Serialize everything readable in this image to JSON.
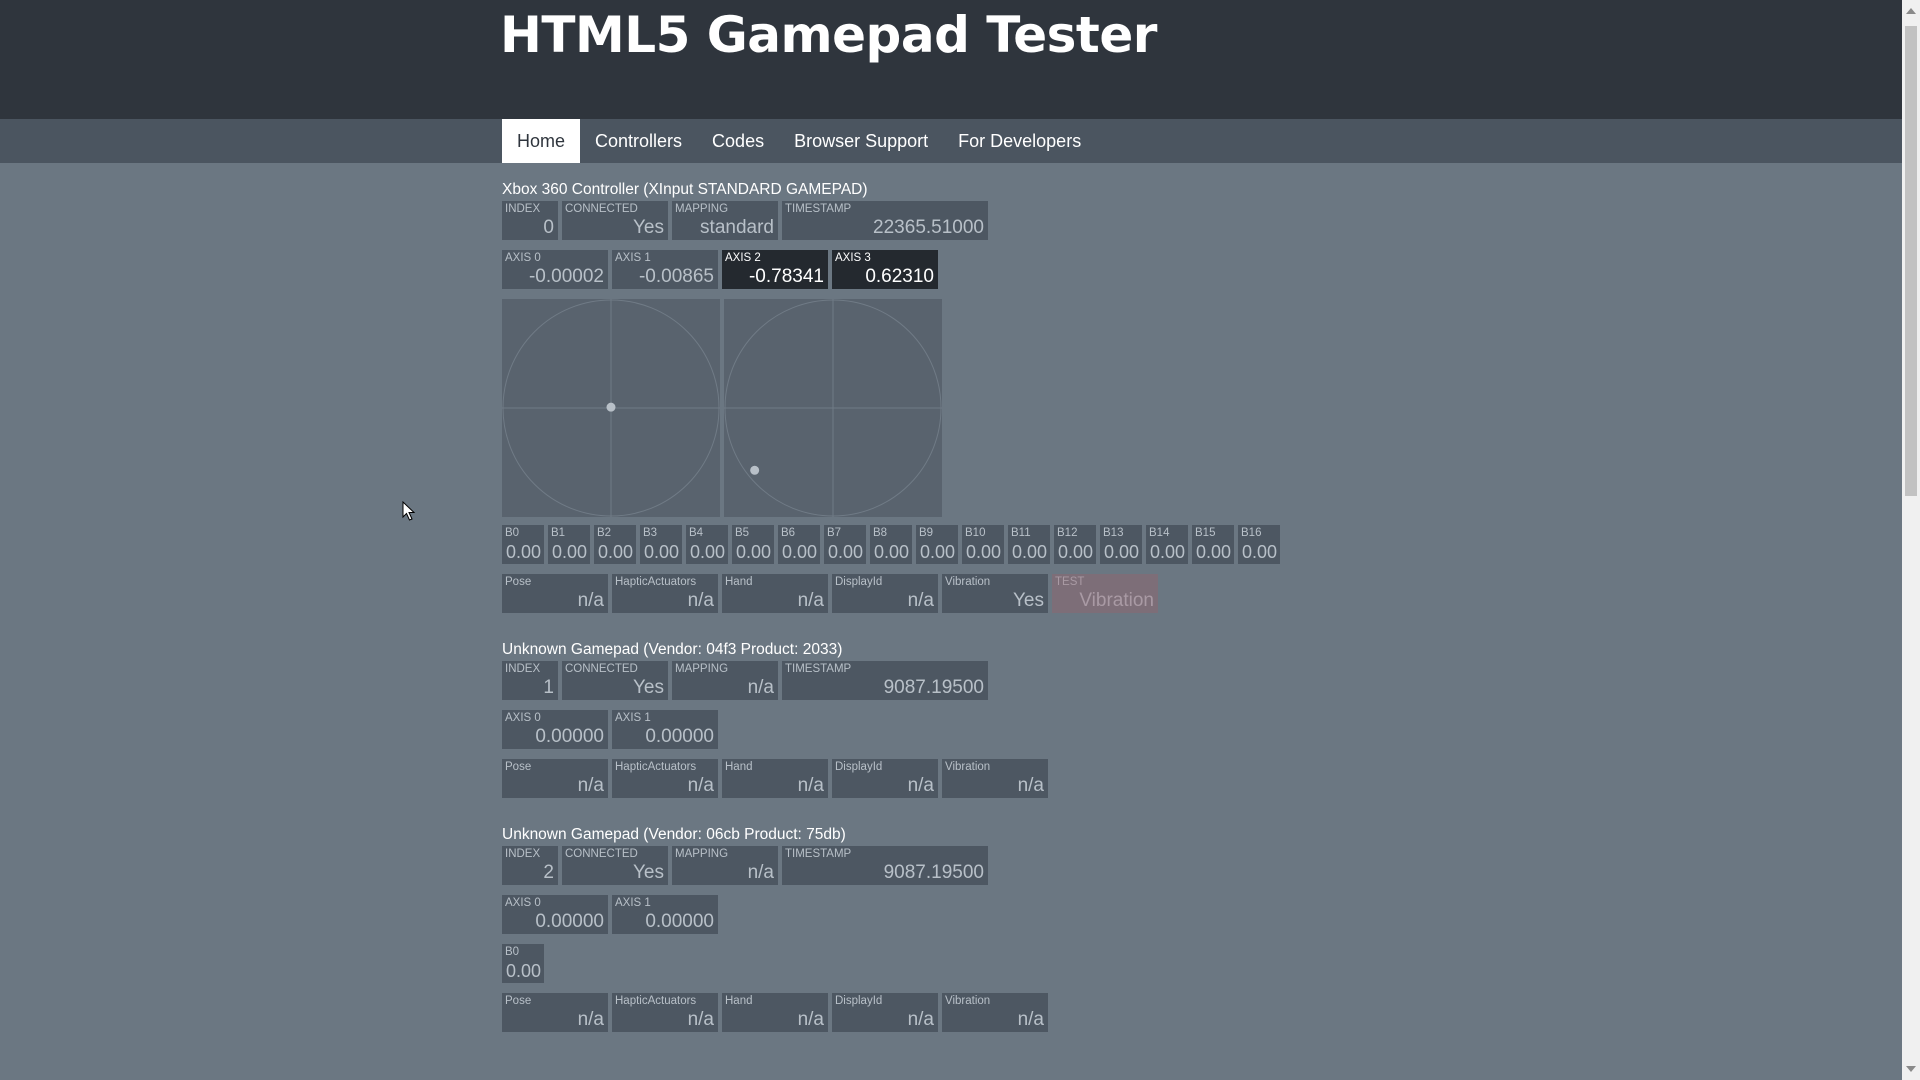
{
  "site": {
    "title": "HTML5 Gamepad Tester"
  },
  "nav": {
    "items": [
      {
        "label": "Home"
      },
      {
        "label": "Controllers"
      },
      {
        "label": "Codes"
      },
      {
        "label": "Browser Support"
      },
      {
        "label": "For Developers"
      }
    ],
    "active": "Home"
  },
  "gamepads": [
    {
      "title": "Xbox 360 Controller (XInput STANDARD GAMEPAD)",
      "info": [
        {
          "label": "INDEX",
          "value": "0"
        },
        {
          "label": "CONNECTED",
          "value": "Yes"
        },
        {
          "label": "MAPPING",
          "value": "standard"
        },
        {
          "label": "TIMESTAMP",
          "value": "22365.51000"
        }
      ],
      "axes": [
        {
          "label": "AXIS 0",
          "value": "-0.00002",
          "active": false
        },
        {
          "label": "AXIS 1",
          "value": "-0.00865",
          "active": false
        },
        {
          "label": "AXIS 2",
          "value": "-0.78341",
          "active": true
        },
        {
          "label": "AXIS 3",
          "value": "0.62310",
          "active": true
        }
      ],
      "sticks": [
        {
          "x": -2e-05,
          "y": -0.00865
        },
        {
          "x": -0.78341,
          "y": 0.6231
        }
      ],
      "buttons": [
        {
          "label": "B0",
          "value": "0.00"
        },
        {
          "label": "B1",
          "value": "0.00"
        },
        {
          "label": "B2",
          "value": "0.00"
        },
        {
          "label": "B3",
          "value": "0.00"
        },
        {
          "label": "B4",
          "value": "0.00"
        },
        {
          "label": "B5",
          "value": "0.00"
        },
        {
          "label": "B6",
          "value": "0.00"
        },
        {
          "label": "B7",
          "value": "0.00"
        },
        {
          "label": "B8",
          "value": "0.00"
        },
        {
          "label": "B9",
          "value": "0.00"
        },
        {
          "label": "B10",
          "value": "0.00"
        },
        {
          "label": "B11",
          "value": "0.00"
        },
        {
          "label": "B12",
          "value": "0.00"
        },
        {
          "label": "B13",
          "value": "0.00"
        },
        {
          "label": "B14",
          "value": "0.00"
        },
        {
          "label": "B15",
          "value": "0.00"
        },
        {
          "label": "B16",
          "value": "0.00"
        }
      ],
      "features": [
        {
          "label": "Pose",
          "value": "n/a"
        },
        {
          "label": "HapticActuators",
          "value": "n/a"
        },
        {
          "label": "Hand",
          "value": "n/a"
        },
        {
          "label": "DisplayId",
          "value": "n/a"
        },
        {
          "label": "Vibration",
          "value": "Yes"
        }
      ],
      "test": {
        "label": "TEST",
        "value": "Vibration"
      }
    },
    {
      "title": "Unknown Gamepad (Vendor: 04f3 Product: 2033)",
      "info": [
        {
          "label": "INDEX",
          "value": "1"
        },
        {
          "label": "CONNECTED",
          "value": "Yes"
        },
        {
          "label": "MAPPING",
          "value": "n/a"
        },
        {
          "label": "TIMESTAMP",
          "value": "9087.19500"
        }
      ],
      "axes": [
        {
          "label": "AXIS 0",
          "value": "0.00000"
        },
        {
          "label": "AXIS 1",
          "value": "0.00000"
        }
      ],
      "features": [
        {
          "label": "Pose",
          "value": "n/a"
        },
        {
          "label": "HapticActuators",
          "value": "n/a"
        },
        {
          "label": "Hand",
          "value": "n/a"
        },
        {
          "label": "DisplayId",
          "value": "n/a"
        },
        {
          "label": "Vibration",
          "value": "n/a"
        }
      ]
    },
    {
      "title": "Unknown Gamepad (Vendor: 06cb Product: 75db)",
      "info": [
        {
          "label": "INDEX",
          "value": "2"
        },
        {
          "label": "CONNECTED",
          "value": "Yes"
        },
        {
          "label": "MAPPING",
          "value": "n/a"
        },
        {
          "label": "TIMESTAMP",
          "value": "9087.19500"
        }
      ],
      "axes": [
        {
          "label": "AXIS 0",
          "value": "0.00000"
        },
        {
          "label": "AXIS 1",
          "value": "0.00000"
        }
      ],
      "buttons": [
        {
          "label": "B0",
          "value": "0.00"
        }
      ],
      "features": [
        {
          "label": "Pose",
          "value": "n/a"
        },
        {
          "label": "HapticActuators",
          "value": "n/a"
        },
        {
          "label": "Hand",
          "value": "n/a"
        },
        {
          "label": "DisplayId",
          "value": "n/a"
        },
        {
          "label": "Vibration",
          "value": "n/a"
        }
      ]
    }
  ],
  "icons": {
    "cursor": "mouse-pointer-icon",
    "scroll_up": "scroll-up-arrow-icon",
    "scroll_down": "scroll-down-arrow-icon"
  },
  "colors": {
    "header_bg": "#2f353d",
    "nav_bg": "#4b5560",
    "page_bg": "#6b7782",
    "cell_bg": "#4d5762",
    "active_cell_bg": "#24292f"
  }
}
